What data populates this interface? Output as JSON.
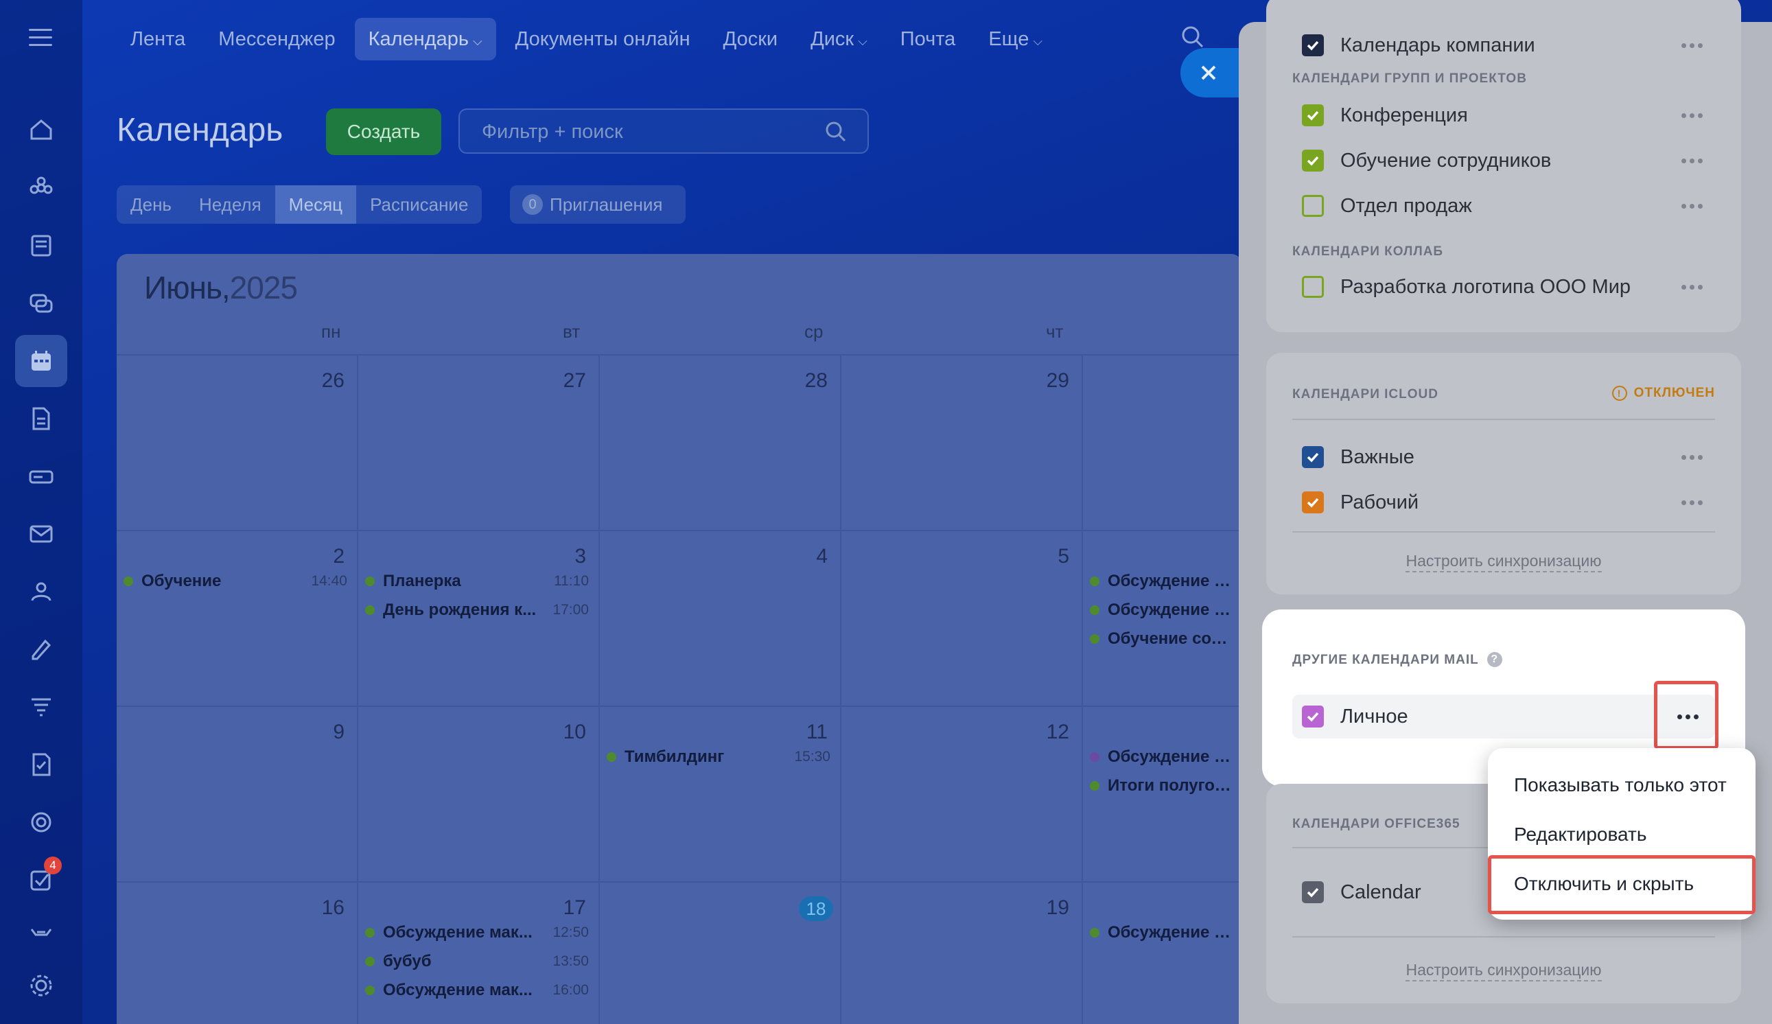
{
  "topnav": {
    "items": [
      "Лента",
      "Мессенджер",
      "Календарь",
      "Документы онлайн",
      "Доски",
      "Диск",
      "Почта",
      "Еще"
    ],
    "active_index": 2
  },
  "sidebar": {
    "icons": [
      "home-icon",
      "flower-icon",
      "newspaper-icon",
      "chat-icon",
      "calendar-icon",
      "document-icon",
      "drive-icon",
      "mail-icon",
      "contacts-icon",
      "sign-icon",
      "filter-funnel-icon",
      "checklist-icon",
      "target-icon",
      "tasks-icon",
      "cat-icon",
      "settings-icon"
    ],
    "tasks_badge": "4"
  },
  "header": {
    "title": "Календарь",
    "create_label": "Создать",
    "search_placeholder": "Фильтр + поиск"
  },
  "views": {
    "items": [
      "День",
      "Неделя",
      "Месяц",
      "Расписание"
    ],
    "active_index": 2,
    "invites_count": "0",
    "invites_label": "Приглашения"
  },
  "calendar": {
    "month": "Июнь,",
    "year": "2025",
    "weekdays": [
      "пн",
      "вт",
      "ср",
      "чт"
    ],
    "weeks": [
      {
        "days": [
          {
            "num": "26",
            "events": []
          },
          {
            "num": "27",
            "events": []
          },
          {
            "num": "28",
            "events": []
          },
          {
            "num": "29",
            "events": []
          },
          {
            "num": "",
            "events": []
          }
        ]
      },
      {
        "days": [
          {
            "num": "2",
            "events": [
              {
                "title": "Обучение",
                "time": "14:40"
              }
            ]
          },
          {
            "num": "3",
            "events": [
              {
                "title": "Планерка",
                "time": "11:10"
              },
              {
                "title": "День рождения к...",
                "time": "17:00"
              }
            ]
          },
          {
            "num": "4",
            "events": []
          },
          {
            "num": "5",
            "events": []
          },
          {
            "num": "",
            "events": [
              {
                "title": "Обсуждение мак",
                "time": ""
              },
              {
                "title": "Обсуждение мак",
                "time": ""
              },
              {
                "title": "Обучение сотруд",
                "time": ""
              }
            ]
          }
        ]
      },
      {
        "days": [
          {
            "num": "9",
            "events": []
          },
          {
            "num": "10",
            "events": []
          },
          {
            "num": "11",
            "events": [
              {
                "title": "Тимбилдинг",
                "time": "15:30"
              }
            ]
          },
          {
            "num": "12",
            "events": []
          },
          {
            "num": "",
            "events": [
              {
                "title": "Обсуждение мак",
                "time": "",
                "color": "purple"
              },
              {
                "title": "Итоги полугодия",
                "time": ""
              }
            ]
          }
        ]
      },
      {
        "days": [
          {
            "num": "16",
            "events": []
          },
          {
            "num": "17",
            "events": [
              {
                "title": "Обсуждение мак...",
                "time": "12:50"
              },
              {
                "title": "бубуб",
                "time": "13:50"
              },
              {
                "title": "Обсуждение мак...",
                "time": "16:00"
              }
            ]
          },
          {
            "num": "18",
            "today": true,
            "events": []
          },
          {
            "num": "19",
            "events": []
          },
          {
            "num": "",
            "events": [
              {
                "title": "Обсуждение мак",
                "time": ""
              }
            ]
          }
        ]
      }
    ]
  },
  "panel": {
    "top_card": {
      "company_calendar": "Календарь компании",
      "groups_title": "КАЛЕНДАРИ ГРУПП И ПРОЕКТОВ",
      "groups": [
        {
          "name": "Конференция",
          "checked": true
        },
        {
          "name": "Обучение сотрудников",
          "checked": true
        },
        {
          "name": "Отдел продаж",
          "checked": false
        }
      ],
      "collab_title": "КАЛЕНДАРИ КОЛЛАБ",
      "collab": [
        {
          "name": "Разработка логотипа ООО Мир",
          "checked": false
        }
      ]
    },
    "icloud": {
      "title": "КАЛЕНДАРИ ICLOUD",
      "status": "ОТКЛЮЧЕН",
      "items": [
        {
          "name": "Важные",
          "checked": true
        },
        {
          "name": "Рабочий",
          "checked": true
        }
      ],
      "sync_label": "Настроить синхронизацию"
    },
    "mail": {
      "title": "ДРУГИЕ КАЛЕНДАРИ MAIL",
      "items": [
        {
          "name": "Личное",
          "checked": true
        }
      ]
    },
    "office365": {
      "title": "КАЛЕНДАРИ OFFICE365",
      "items": [
        {
          "name": "Calendar",
          "checked": true
        }
      ],
      "sync_label": "Настроить синхронизацию"
    },
    "context_menu": {
      "items": [
        "Показывать только этот",
        "Редактировать",
        "Отключить и скрыть"
      ]
    }
  },
  "colors": {
    "check_company": "#1e2a45",
    "check_green": "#7aa520",
    "check_icloud_blue": "#1f4f92",
    "check_icloud_orange": "#d9771a",
    "check_mail": "#b865d3",
    "check_office": "#5a5f6b",
    "highlight": "#e5534b"
  }
}
